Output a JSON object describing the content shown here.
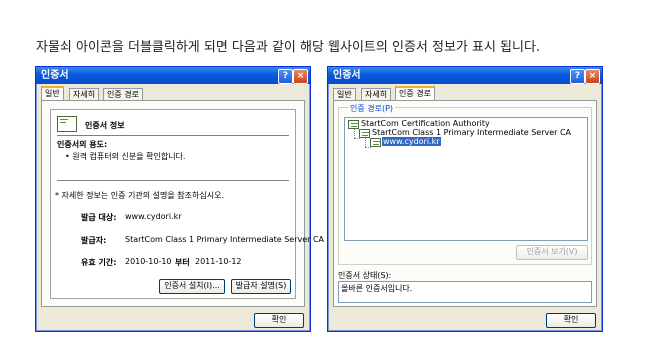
{
  "caption": "자물쇠 아이콘을 더블클릭하게 되면 다음과 같이 해당 웹사이트의 인증서 정보가 표시 됩니다.",
  "left_window": {
    "title": "인증서",
    "help_glyph": "?",
    "close_glyph": "×",
    "tabs": [
      "일반",
      "자세히",
      "인증 경로"
    ],
    "header": "인증서 정보",
    "purpose_label": "인증서의 용도:",
    "purpose_item": "• 원격 컴퓨터의 신분을 확인합니다.",
    "note": "* 자세한 정보는 인증 기관의 설명을 참조하십시오.",
    "issued_to_label": "발급 대상:",
    "issued_to_value": "www.cydori.kr",
    "issued_by_label": "발급자:",
    "issued_by_value": "StartCom Class 1 Primary Intermediate Server CA",
    "validity_label": "유효 기간:",
    "valid_from": "2010-10-10",
    "validity_to_word": "부터",
    "valid_to": "2011-10-12",
    "install_button": "인증서 설치(I)...",
    "issuer_statement_button": "발급자 설명(S)",
    "ok_button": "확인"
  },
  "right_window": {
    "title": "인증서",
    "help_glyph": "?",
    "close_glyph": "×",
    "tabs": [
      "일반",
      "자세히",
      "인증 경로"
    ],
    "path_label": "인증 경로(P)",
    "path": [
      "StartCom Certification Authority",
      "StartCom Class 1 Primary Intermediate Server CA",
      "www.cydori.kr"
    ],
    "view_cert_button": "인증서 보기(V)",
    "status_label": "인증서 상태(S):",
    "status_value": "올바른 인증서입니다.",
    "ok_button": "확인"
  }
}
